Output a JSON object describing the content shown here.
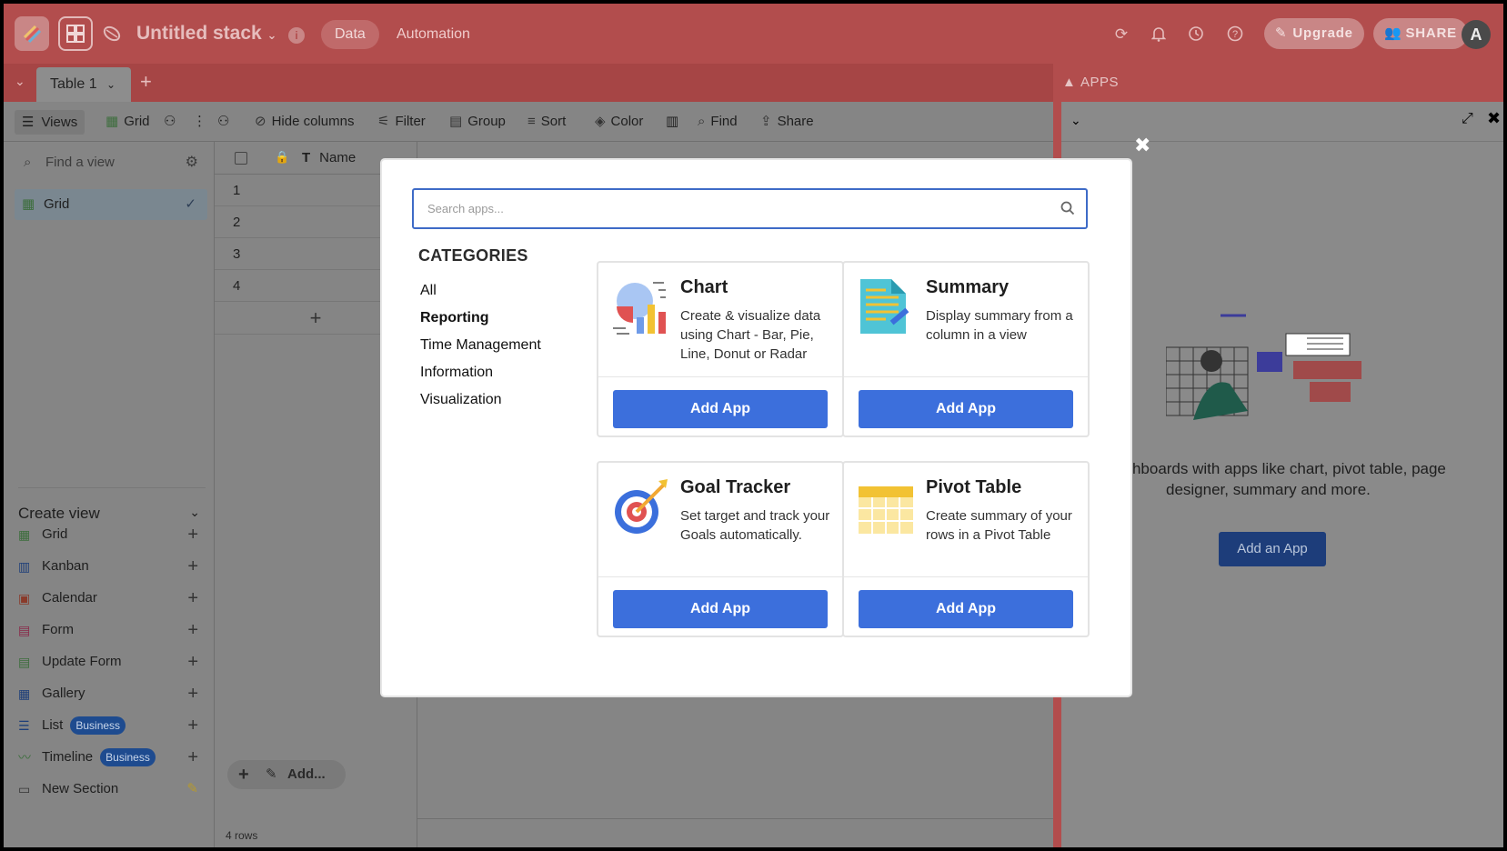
{
  "header": {
    "stack_title": "Untitled stack",
    "tabs": [
      "Data",
      "Automation"
    ],
    "upgrade_label": "Upgrade",
    "share_label": "SHARE",
    "avatar_letter": "A"
  },
  "tabs_bar": {
    "table_tab": "Table 1",
    "apps_title": "APPS"
  },
  "toolbar": {
    "views": "Views",
    "grid": "Grid",
    "hide_columns": "Hide columns",
    "filter": "Filter",
    "group": "Group",
    "sort": "Sort",
    "color": "Color",
    "find": "Find",
    "share": "Share"
  },
  "sidebar": {
    "find_placeholder": "Find a view",
    "active_view": "Grid",
    "create_view_title": "Create view",
    "items": [
      {
        "label": "Grid",
        "icon": "grid-icon",
        "color": "#3d6e3d"
      },
      {
        "label": "Kanban",
        "icon": "kanban-icon",
        "color": "#1e3f7a"
      },
      {
        "label": "Calendar",
        "icon": "calendar-icon",
        "color": "#8a3a2a"
      },
      {
        "label": "Form",
        "icon": "form-icon",
        "color": "#8a2a4a"
      },
      {
        "label": "Update Form",
        "icon": "update-form-icon",
        "color": "#3d6e3d"
      },
      {
        "label": "Gallery",
        "icon": "gallery-icon",
        "color": "#1e3f7a"
      },
      {
        "label": "List",
        "icon": "list-icon",
        "color": "#1e3f7a",
        "badge": "Business"
      },
      {
        "label": "Timeline",
        "icon": "timeline-icon",
        "color": "#3d6e3d",
        "badge": "Business"
      },
      {
        "label": "New Section",
        "icon": "folder-icon",
        "color": "#333333"
      }
    ]
  },
  "grid": {
    "name_column": "Name",
    "rows": [
      "1",
      "2",
      "3",
      "4"
    ],
    "add_label": "Add...",
    "rows_count": "4 rows"
  },
  "apps_panel": {
    "text_line1": "ashboards with apps like chart, pivot table, page",
    "text_line2": "designer, summary and more.",
    "add_button": "Add an App"
  },
  "modal": {
    "search_placeholder": "Search apps...",
    "categories_title": "CATEGORIES",
    "categories": [
      "All",
      "Reporting",
      "Time Management",
      "Information",
      "Visualization"
    ],
    "selected_category": "Reporting",
    "apps": [
      {
        "title": "Chart",
        "description": "Create & visualize data using Chart - Bar, Pie, Line, Donut or Radar",
        "button": "Add App",
        "icon": "chart-icon"
      },
      {
        "title": "Summary",
        "description": "Display summary from a column in a view",
        "button": "Add App",
        "icon": "summary-icon"
      },
      {
        "title": "Goal Tracker",
        "description": "Set target and track your Goals automatically.",
        "button": "Add App",
        "icon": "goal-tracker-icon"
      },
      {
        "title": "Pivot Table",
        "description": "Create summary of your rows in a Pivot Table",
        "button": "Add App",
        "icon": "pivot-table-icon"
      }
    ]
  },
  "colors": {
    "header_red": "#b24d4d",
    "primary_blue": "#3c6fdc",
    "overlay_gray": "#8a8a8a"
  }
}
